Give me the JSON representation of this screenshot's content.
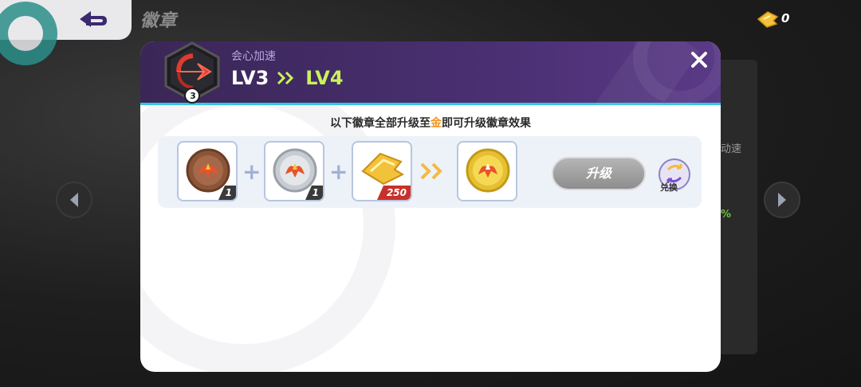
{
  "screen": {
    "title": "徽章"
  },
  "currency": {
    "icon": "ticket-icon",
    "count": "0"
  },
  "background": {
    "side_text": "动速",
    "side_percent": "%"
  },
  "dialog": {
    "skill_name": "会心加速",
    "badge_level": "3",
    "level_from": "LV3",
    "level_to": "LV4",
    "instruction_before": "以下徽章全部升级至",
    "instruction_highlight": "金",
    "instruction_after": "即可升级徽章效果",
    "materials": [
      {
        "name": "bronze-badge",
        "quantity": "1"
      },
      {
        "name": "silver-badge",
        "quantity": "1"
      },
      {
        "name": "ticket",
        "quantity": "250"
      }
    ],
    "result": {
      "name": "gold-badge"
    },
    "upgrade_label": "升级",
    "exchange_label": "兑换"
  },
  "colors": {
    "header_purple": "#4a2f72",
    "accent_cyan": "#34c7e0",
    "level_green": "#c9f25a",
    "highlight_orange": "#f0941c",
    "cost_red": "#c8312b"
  }
}
